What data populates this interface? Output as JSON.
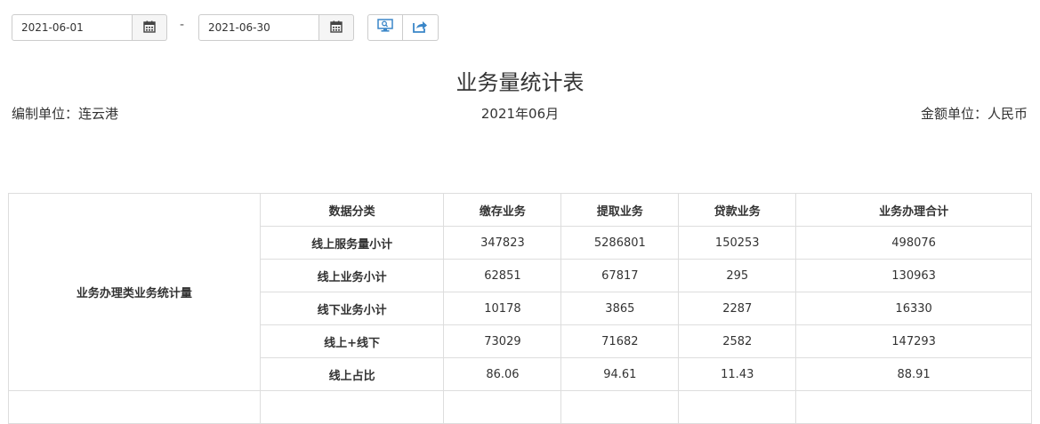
{
  "toolbar": {
    "start_date": "2021-06-01",
    "end_date": "2021-06-30",
    "separator": "-",
    "calendar_icon": "calendar-icon",
    "query_icon": "monitor-search-icon",
    "export_icon": "share-export-icon"
  },
  "report": {
    "title": "业务量统计表",
    "unit_label": "编制单位：连云港",
    "period": "2021年06月",
    "currency_label": "金额单位：人民币"
  },
  "table": {
    "group_label": "业务办理类业务统计量",
    "headers": [
      "数据分类",
      "缴存业务",
      "提取业务",
      "贷款业务",
      "业务办理合计"
    ],
    "rows": [
      {
        "label": "线上服务量小计",
        "values": [
          "347823",
          "5286801",
          "150253",
          "498076"
        ]
      },
      {
        "label": "线上业务小计",
        "values": [
          "62851",
          "67817",
          "295",
          "130963"
        ]
      },
      {
        "label": "线下业务小计",
        "values": [
          "10178",
          "3865",
          "2287",
          "16330"
        ]
      },
      {
        "label": "线上+线下",
        "values": [
          "73029",
          "71682",
          "2582",
          "147293"
        ]
      },
      {
        "label": "线上占比",
        "values": [
          "86.06",
          "94.61",
          "11.43",
          "88.91"
        ]
      }
    ]
  },
  "colors": {
    "icon_blue": "#3a86c8",
    "border": "#dddddd",
    "text": "#333333"
  }
}
